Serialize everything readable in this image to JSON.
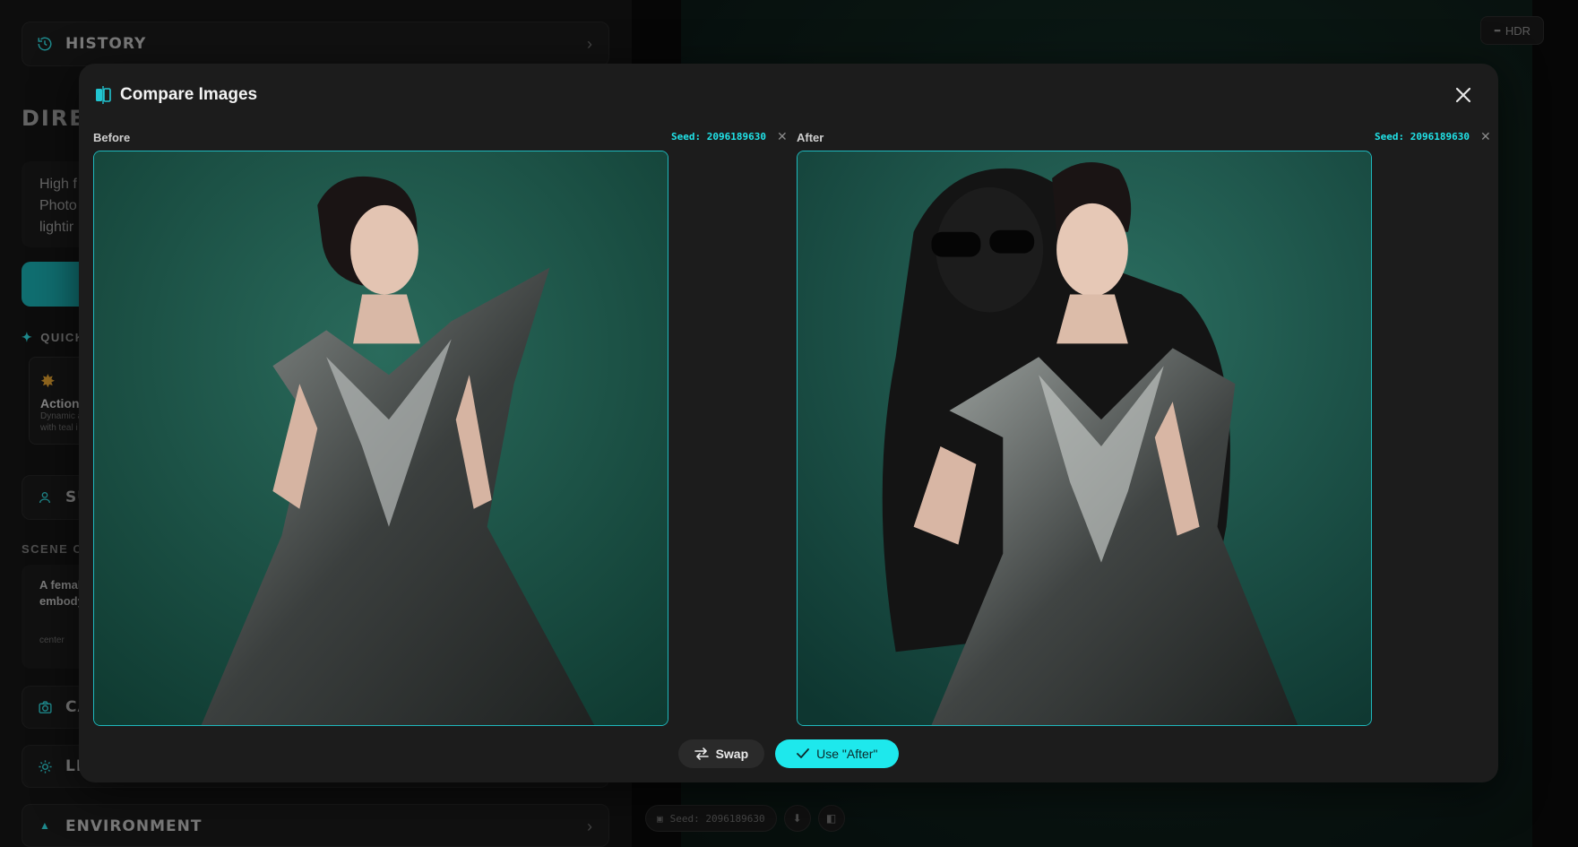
{
  "sidebar": {
    "history_label": "HISTORY",
    "director_heading": "DIREC",
    "prompt_lines": [
      "High f",
      "Photo",
      "lightir"
    ],
    "quick_label": "QUICK",
    "quick_card": {
      "title": "Action",
      "desc_lines": [
        "Dynamic a",
        "with teal i"
      ]
    },
    "subject_label": "SU",
    "scene_label": "SCENE OF",
    "scene_text_lines": [
      "A female",
      "embodyir"
    ],
    "scene_position": "center",
    "camera_label": "CA",
    "lighting_label": "LIG",
    "environment_label": "ENVIRONMENT"
  },
  "canvas": {
    "hdr_label": "HDR",
    "seed_text": "Seed: 2096189630"
  },
  "modal": {
    "title": "Compare Images",
    "before": {
      "label": "Before",
      "seed": "Seed: 2096189630"
    },
    "after": {
      "label": "After",
      "seed": "Seed: 2096189630"
    },
    "swap_label": "Swap",
    "use_label": "Use \"After\""
  },
  "colors": {
    "accent": "#1ee8ec",
    "frame_border": "#1fb8bd",
    "modal_bg": "#1c1c1c",
    "backdrop": "#1e5a4d"
  }
}
